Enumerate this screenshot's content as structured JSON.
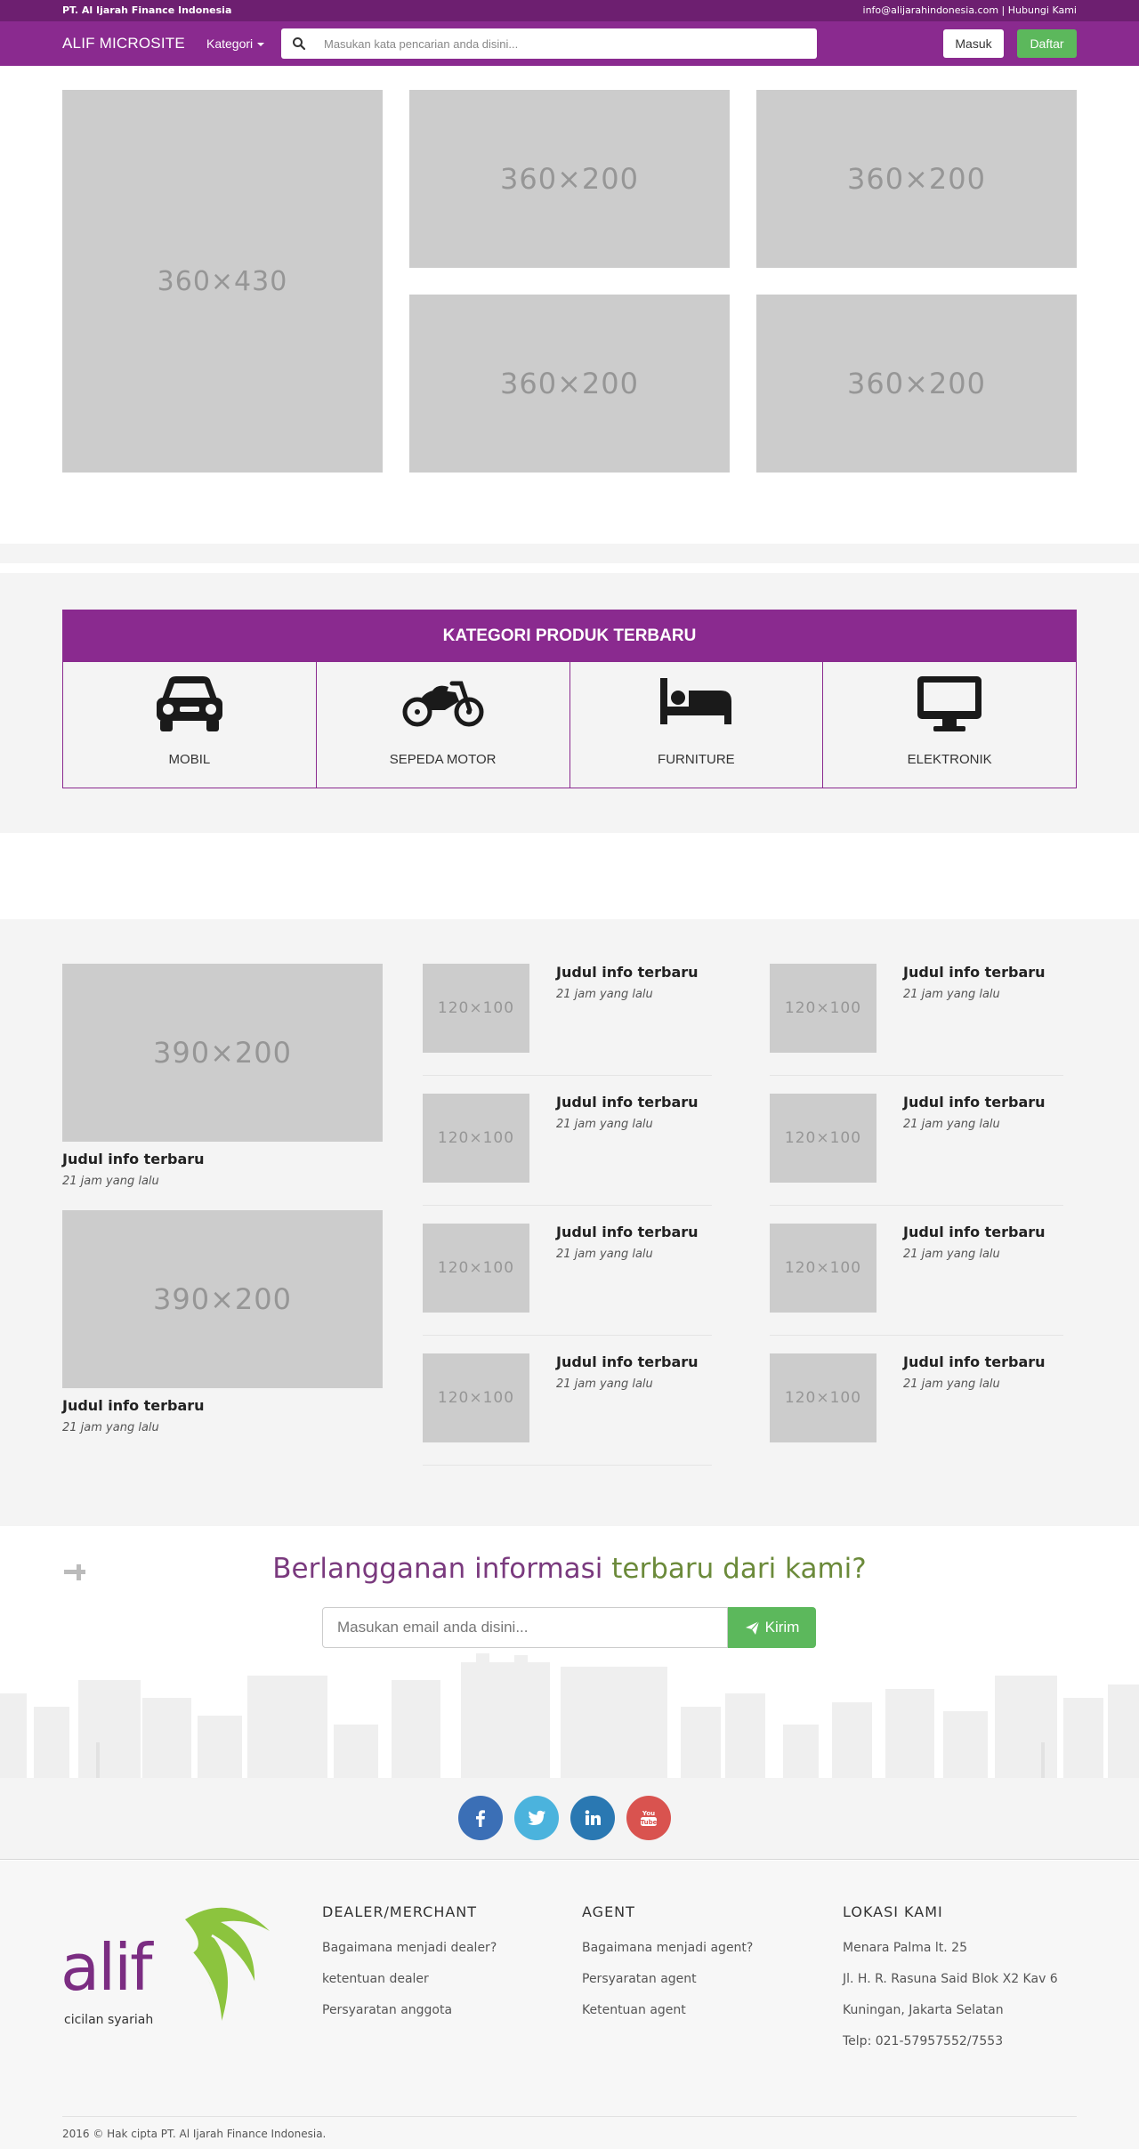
{
  "topbar": {
    "company": "PT. Al Ijarah Finance Indonesia",
    "email": "info@alijarahindonesia.com",
    "separator": " | ",
    "contact_link": "Hubungi Kami"
  },
  "navbar": {
    "brand": "ALIF MICROSITE",
    "kategori_label": "Kategori",
    "search_placeholder": "Masukan kata pencarian anda disini...",
    "login_label": "Masuk",
    "register_label": "Daftar",
    "accent_color": "#8a2a8f",
    "register_color": "#5cb85c"
  },
  "hero": {
    "main": "360×430",
    "tiles": [
      "360×200",
      "360×200",
      "360×200",
      "360×200"
    ]
  },
  "kategori": {
    "title": "KATEGORI PRODUK TERBARU",
    "items": [
      {
        "label": "MOBIL",
        "icon": "car-icon"
      },
      {
        "label": "SEPEDA MOTOR",
        "icon": "motorcycle-icon"
      },
      {
        "label": "FURNITURE",
        "icon": "bed-icon"
      },
      {
        "label": "ELEKTRONIK",
        "icon": "desktop-icon"
      }
    ]
  },
  "news": {
    "featured": [
      {
        "image": "390×200",
        "title": "Judul info terbaru",
        "time": "21 jam yang lalu"
      },
      {
        "image": "390×200",
        "title": "Judul info terbaru",
        "time": "21 jam yang lalu"
      }
    ],
    "col2": [
      {
        "image": "120×100",
        "title": "Judul info terbaru",
        "time": "21 jam yang lalu"
      },
      {
        "image": "120×100",
        "title": "Judul info terbaru",
        "time": "21 jam yang lalu"
      },
      {
        "image": "120×100",
        "title": "Judul info terbaru",
        "time": "21 jam yang lalu"
      },
      {
        "image": "120×100",
        "title": "Judul info terbaru",
        "time": "21 jam yang lalu"
      }
    ],
    "col3": [
      {
        "image": "120×100",
        "title": "Judul info terbaru",
        "time": "21 jam yang lalu"
      },
      {
        "image": "120×100",
        "title": "Judul info terbaru",
        "time": "21 jam yang lalu"
      },
      {
        "image": "120×100",
        "title": "Judul info terbaru",
        "time": "21 jam yang lalu"
      },
      {
        "image": "120×100",
        "title": "Judul info terbaru",
        "time": "21 jam yang lalu"
      }
    ]
  },
  "subscribe": {
    "title_part1": "Berlangganan informasi ",
    "title_part2": "terbaru dari kami?",
    "placeholder": "Masukan email anda disini...",
    "button": "Kirim"
  },
  "social": [
    {
      "icon": "facebook-icon",
      "color": "#3b6fb6"
    },
    {
      "icon": "twitter-icon",
      "color": "#4bb3dd"
    },
    {
      "icon": "linkedin-icon",
      "color": "#2a78b2"
    },
    {
      "icon": "youtube-icon",
      "color": "#d9534f"
    }
  ],
  "footer": {
    "logo_text": "alif",
    "logo_tagline": "cicilan syariah",
    "dealer": {
      "title": "DEALER/MERCHANT",
      "links": [
        "Bagaimana menjadi dealer?",
        "ketentuan dealer",
        "Persyaratan anggota"
      ]
    },
    "agent": {
      "title": "AGENT",
      "links": [
        "Bagaimana menjadi agent?",
        "Persyaratan agent",
        "Ketentuan agent"
      ]
    },
    "lokasi": {
      "title": "LOKASI KAMI",
      "lines": [
        "Menara Palma lt. 25",
        "Jl. H. R. Rasuna Said Blok X2 Kav 6",
        "Kuningan, Jakarta Selatan",
        "Telp: 021-57957552/7553"
      ]
    },
    "copyright": "2016 © Hak cipta PT. Al Ijarah Finance Indonesia."
  }
}
